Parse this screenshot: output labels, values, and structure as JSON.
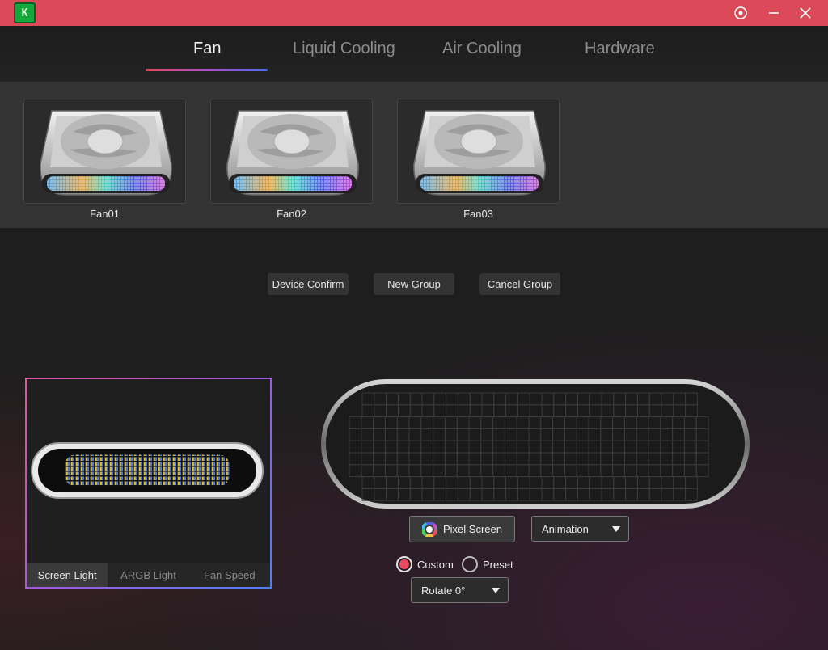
{
  "titlebar": {
    "logo_text": "K",
    "icons": [
      "settings-icon",
      "minimize-icon",
      "close-icon"
    ]
  },
  "tabs": [
    {
      "label": "Fan",
      "active": true
    },
    {
      "label": "Liquid Cooling",
      "active": false
    },
    {
      "label": "Air Cooling",
      "active": false
    },
    {
      "label": "Hardware",
      "active": false
    }
  ],
  "devices": [
    {
      "name": "Fan01"
    },
    {
      "name": "Fan02"
    },
    {
      "name": "Fan03"
    }
  ],
  "group_actions": {
    "device_confirm": "Device Confirm",
    "new_group": "New Group",
    "cancel_group": "Cancel Group"
  },
  "preview_tabs": [
    {
      "label": "Screen Light",
      "active": true
    },
    {
      "label": "ARGB Light",
      "active": false
    },
    {
      "label": "Fan Speed",
      "active": false
    }
  ],
  "controls": {
    "pixel_screen_label": "Pixel Screen",
    "animation_select": "Animation",
    "mode_options": [
      {
        "label": "Custom",
        "selected": true
      },
      {
        "label": "Preset",
        "selected": false
      }
    ],
    "rotate_select": "Rotate 0°"
  },
  "colors": {
    "titlebar": "#dc4a59",
    "accent_gradient": [
      "#e84a5f",
      "#b050d0",
      "#4f6ef0"
    ],
    "radio_selected": "#e84a5f"
  }
}
